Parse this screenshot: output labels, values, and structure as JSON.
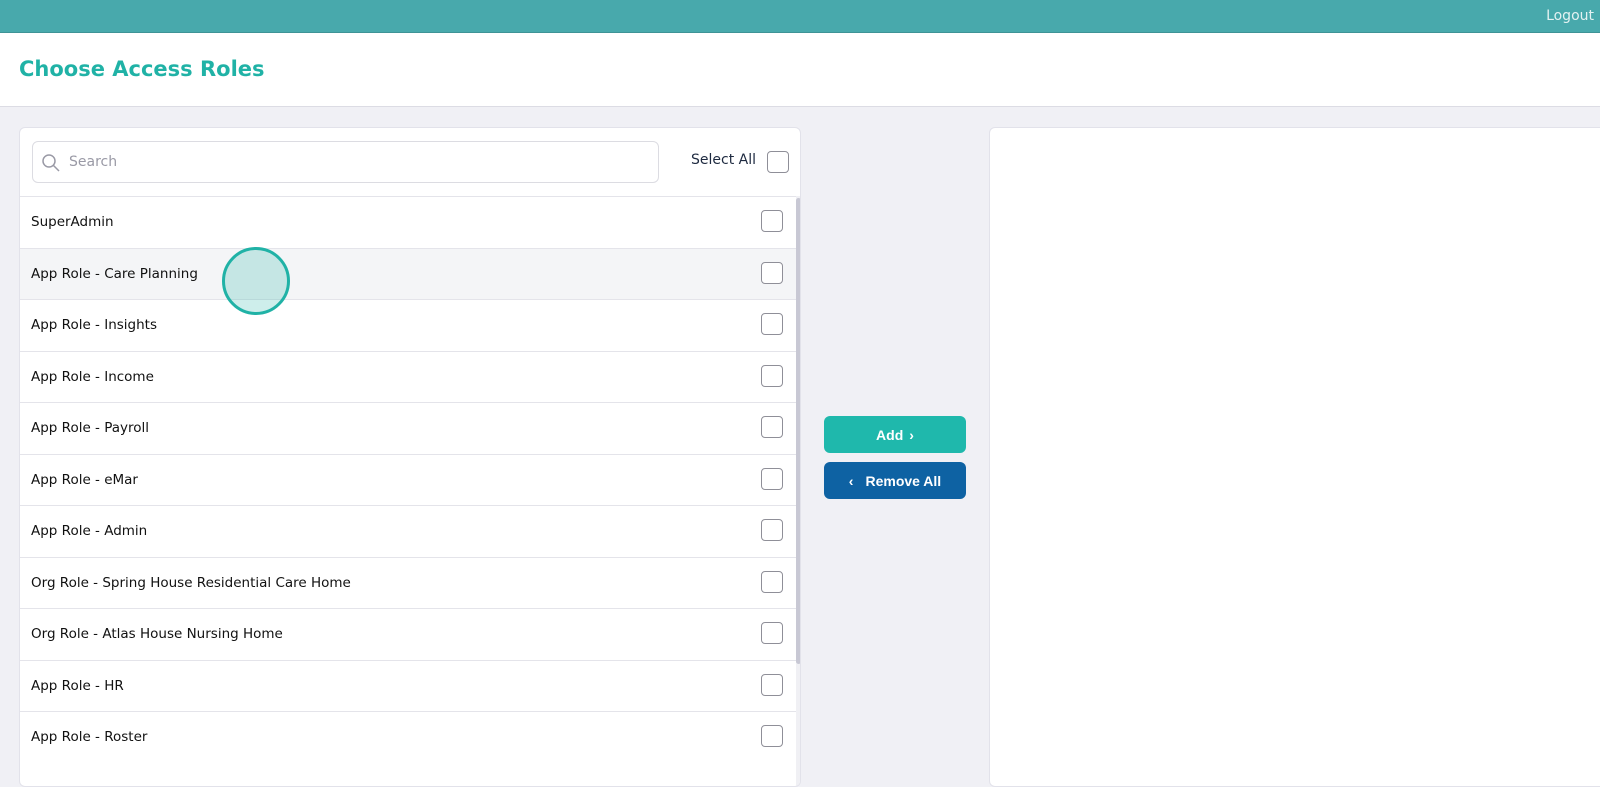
{
  "topbar": {
    "logout_label": "Logout"
  },
  "header": {
    "title": "Choose Access Roles"
  },
  "search": {
    "placeholder": "Search",
    "value": ""
  },
  "select_all_label": "Select All",
  "roles": [
    "SuperAdmin",
    "App Role - Care Planning",
    "App Role - Insights",
    "App Role - Income",
    "App Role - Payroll",
    "App Role - eMar",
    "App Role - Admin",
    "Org Role - Spring House Residential Care Home",
    "Org Role - Atlas House Nursing Home",
    "App Role - HR",
    "App Role - Roster"
  ],
  "buttons": {
    "add_label": "Add",
    "remove_all_label": "Remove All"
  },
  "colors": {
    "accent": "#1fb8ac",
    "topbar": "#48a9ac",
    "remove": "#0e62a3"
  }
}
